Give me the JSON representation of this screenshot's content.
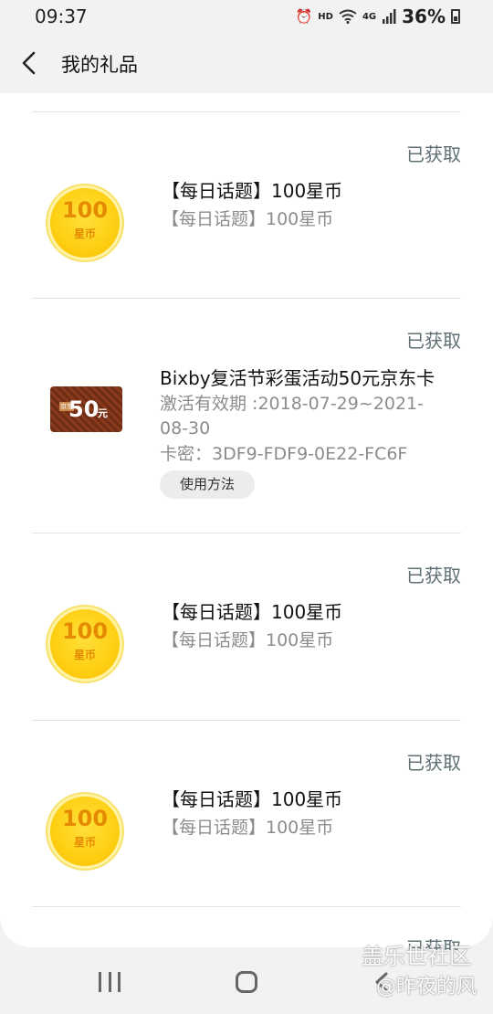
{
  "status_bar": {
    "time": "09:37",
    "hd": "HD",
    "network": "4G",
    "battery": "36%"
  },
  "header": {
    "title": "我的礼品"
  },
  "gifts": [
    {
      "status": "已获取",
      "title": "【每日话题】100星币",
      "subtitle": "【每日话题】100星币",
      "coin_amount": "100",
      "coin_unit": "星币"
    },
    {
      "status": "已获取",
      "title": "Bixby复活节彩蛋活动50元京东卡",
      "validity": "激活有效期 :2018-07-29~2021-08-30",
      "card_code": "卡密：3DF9-FDF9-0E22-FC6F",
      "button": "使用方法",
      "card_badge": "京东",
      "card_amount": "50",
      "card_unit": "元"
    },
    {
      "status": "已获取",
      "title": "【每日话题】100星币",
      "subtitle": "【每日话题】100星币",
      "coin_amount": "100",
      "coin_unit": "星币"
    },
    {
      "status": "已获取",
      "title": "【每日话题】100星币",
      "subtitle": "【每日话题】100星币",
      "coin_amount": "100",
      "coin_unit": "星币"
    }
  ],
  "peek_status": "已获取",
  "watermark": {
    "line1": "盖乐世社区",
    "line2": "@昨夜的风"
  }
}
